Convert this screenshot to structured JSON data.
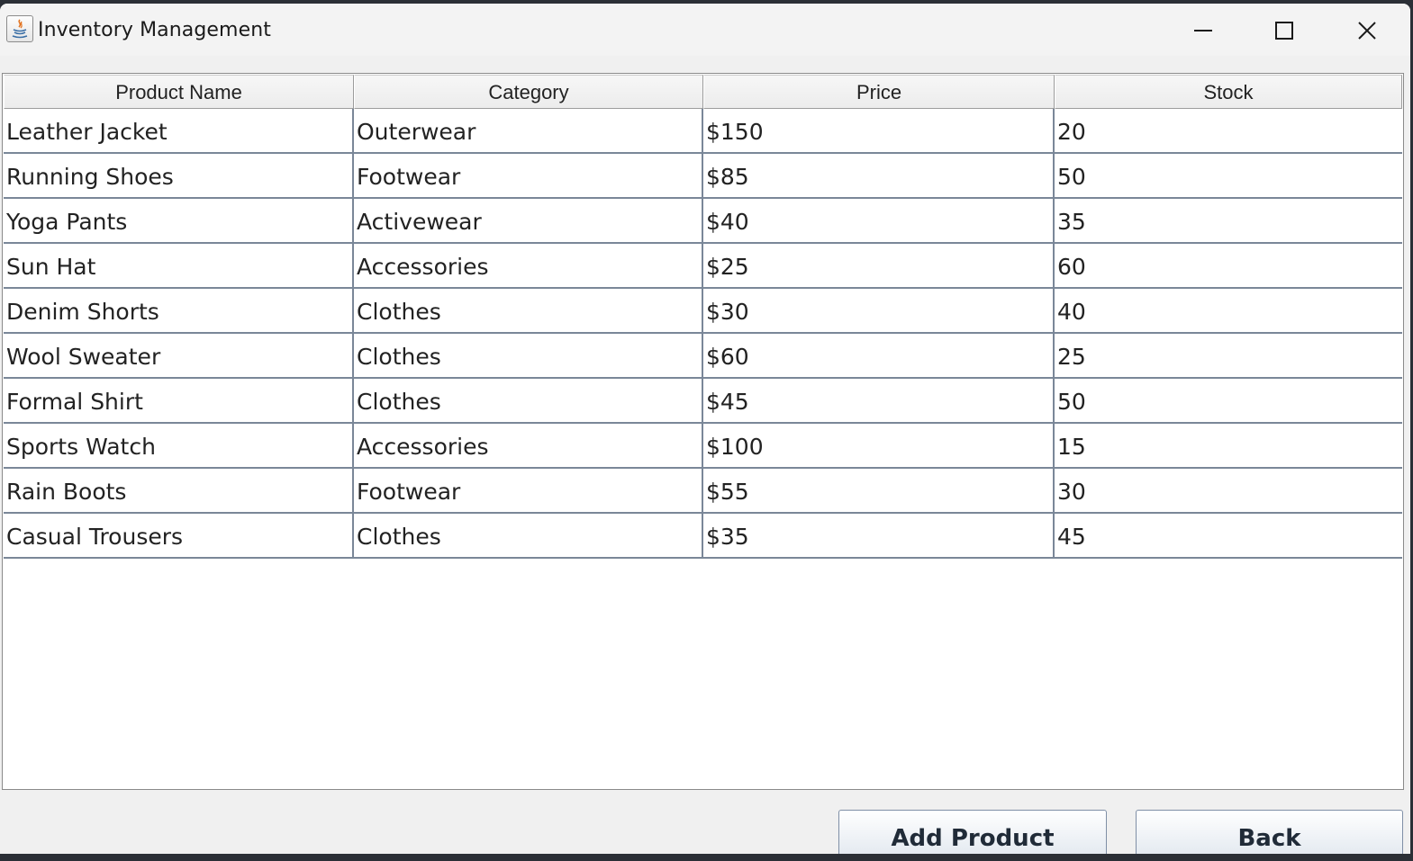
{
  "window": {
    "title": "Inventory Management",
    "icon": "java-icon"
  },
  "table": {
    "columns": [
      "Product Name",
      "Category",
      "Price",
      "Stock"
    ],
    "rows": [
      [
        "Leather Jacket",
        "Outerwear",
        "$150",
        "20"
      ],
      [
        "Running Shoes",
        "Footwear",
        "$85",
        "50"
      ],
      [
        "Yoga Pants",
        "Activewear",
        "$40",
        "35"
      ],
      [
        "Sun Hat",
        "Accessories",
        "$25",
        "60"
      ],
      [
        "Denim Shorts",
        "Clothes",
        "$30",
        "40"
      ],
      [
        "Wool Sweater",
        "Clothes",
        "$60",
        "25"
      ],
      [
        "Formal Shirt",
        "Clothes",
        "$45",
        "50"
      ],
      [
        "Sports Watch",
        "Accessories",
        "$100",
        "15"
      ],
      [
        "Rain Boots",
        "Footwear",
        "$55",
        "30"
      ],
      [
        "Casual Trousers",
        "Clothes",
        "$35",
        "45"
      ]
    ]
  },
  "actions": {
    "add_label": "Add Product",
    "back_label": "Back"
  },
  "colors": {
    "grid": "#7a8798",
    "window_bg": "#f0f0f0"
  }
}
